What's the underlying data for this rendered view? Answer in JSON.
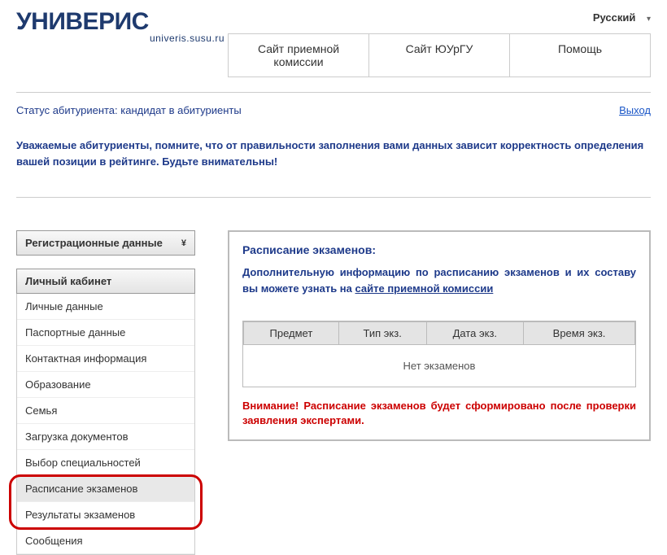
{
  "lang": {
    "label": "Русский",
    "arrow": "▾"
  },
  "logo": {
    "text": "УНИВЕРИС",
    "sub": "univeris.susu.ru"
  },
  "nav": {
    "items": [
      "Сайт приемной комиссии",
      "Сайт ЮУрГУ",
      "Помощь"
    ]
  },
  "status": "Статус абитуриента: кандидат в абитуриенты",
  "logout": "Выход",
  "notice": "Уважаемые абитуриенты, помните, что от правильности заполнения вами данных зависит корректность определения вашей позиции в рейтинге. Будьте внимательны!",
  "sidebar": {
    "reg": "Регистрационные данные",
    "reg_arrow": "¥",
    "menu_header": "Личный кабинет",
    "items": [
      "Личные данные",
      "Паспортные данные",
      "Контактная информация",
      "Образование",
      "Семья",
      "Загрузка документов",
      "Выбор специальностей",
      "Расписание экзаменов",
      "Результаты экзаменов",
      "Сообщения"
    ]
  },
  "content": {
    "title": "Расписание экзаменов:",
    "info_prefix": "Дополнительную информацию по расписанию экзаменов и их составу вы можете узнать на ",
    "info_link": "сайте приемной комиссии",
    "table": {
      "headers": [
        "Предмет",
        "Тип экз.",
        "Дата экз.",
        "Время экз."
      ],
      "empty": "Нет экзаменов"
    },
    "warning": "Внимание! Расписание экзаменов будет сформировано после проверки заявления экспертами."
  }
}
